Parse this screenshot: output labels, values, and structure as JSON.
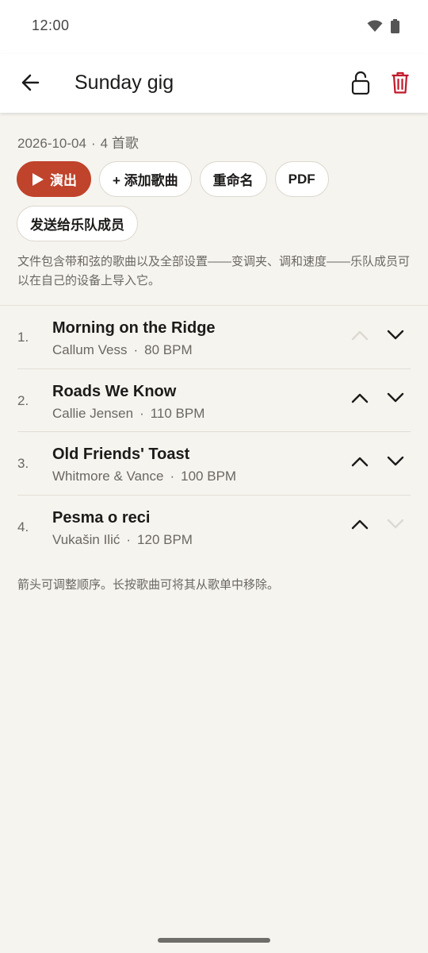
{
  "status_bar": {
    "time": "12:00",
    "icons": [
      "wifi-icon",
      "battery-icon"
    ]
  },
  "app_bar": {
    "title": "Sunday gig",
    "back_icon": "arrow-left-icon",
    "lock_icon": "unlock-icon",
    "delete_icon": "trash-icon",
    "delete_color": "#c0192b"
  },
  "setlist": {
    "date": "2026-10-04",
    "separator": "·",
    "song_count": "4 首歌"
  },
  "actions": {
    "perform_label": "演出",
    "add_song_label": "+ 添加歌曲",
    "rename_label": "重命名",
    "pdf_label": "PDF",
    "send_label": "发送给乐队成员",
    "accent": "#c0432b"
  },
  "info_text": "文件包含带和弦的歌曲以及全部设置——变调夹、调和速度——乐队成员可以在自己的设备上导入它。",
  "songs": [
    {
      "num": "1.",
      "title": "Morning on the Ridge",
      "artist": "Callum Vess",
      "bpm": "80 BPM",
      "up_enabled": false,
      "down_enabled": true
    },
    {
      "num": "2.",
      "title": "Roads We Know",
      "artist": "Callie Jensen",
      "bpm": "110 BPM",
      "up_enabled": true,
      "down_enabled": true
    },
    {
      "num": "3.",
      "title": "Old Friends' Toast",
      "artist": "Whitmore & Vance",
      "bpm": "100 BPM",
      "up_enabled": true,
      "down_enabled": true
    },
    {
      "num": "4.",
      "title": "Pesma o reci",
      "artist": "Vukašin Ilić",
      "bpm": "120 BPM",
      "up_enabled": true,
      "down_enabled": false
    }
  ],
  "hint": "箭头可调整顺序。长按歌曲可将其从歌单中移除。"
}
